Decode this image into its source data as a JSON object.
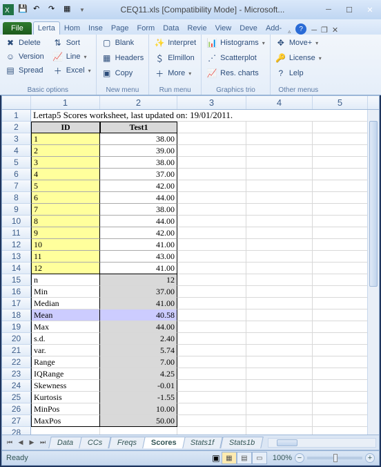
{
  "title": "CEQ11.xls  [Compatibility Mode] - Microsoft...",
  "tabs": {
    "file": "File",
    "active": "Lerta",
    "others": [
      "Hom",
      "Inse",
      "Page",
      "Form",
      "Data",
      "Revie",
      "View",
      "Deve",
      "Add-"
    ]
  },
  "ribbon": {
    "g1": {
      "label": "Basic options",
      "delete": "Delete",
      "version": "Version",
      "spread": "Spread",
      "sort": "Sort",
      "line": "Line",
      "excel": "Excel"
    },
    "g2": {
      "label": "New menu",
      "blank": "Blank",
      "headers": "Headers",
      "copy": "Copy"
    },
    "g3": {
      "label": "Run menu",
      "interpret": "Interpret",
      "elmillon": "Elmillon",
      "more": "More"
    },
    "g4": {
      "label": "Graphics trio",
      "histograms": "Histograms",
      "scatterplot": "Scatterplot",
      "rescharts": "Res. charts"
    },
    "g5": {
      "label": "Other menus",
      "move": "Move+",
      "license": "License",
      "lelp": "Lelp"
    }
  },
  "columns": [
    "1",
    "2",
    "3",
    "4",
    "5"
  ],
  "row_title": "Lertap5 Scores worksheet, last updated on: 19/01/2011.",
  "headers": {
    "id": "ID",
    "test": "Test1"
  },
  "data_rows": [
    {
      "r": "3",
      "id": "1",
      "v": "38.00"
    },
    {
      "r": "4",
      "id": "2",
      "v": "39.00"
    },
    {
      "r": "5",
      "id": "3",
      "v": "38.00"
    },
    {
      "r": "6",
      "id": "4",
      "v": "37.00"
    },
    {
      "r": "7",
      "id": "5",
      "v": "42.00"
    },
    {
      "r": "8",
      "id": "6",
      "v": "44.00"
    },
    {
      "r": "9",
      "id": "7",
      "v": "38.00"
    },
    {
      "r": "10",
      "id": "8",
      "v": "44.00"
    },
    {
      "r": "11",
      "id": "9",
      "v": "42.00"
    },
    {
      "r": "12",
      "id": "10",
      "v": "41.00"
    },
    {
      "r": "13",
      "id": "11",
      "v": "43.00"
    },
    {
      "r": "14",
      "id": "12",
      "v": "41.00"
    }
  ],
  "stat_rows": [
    {
      "r": "15",
      "l": "n",
      "v": "12"
    },
    {
      "r": "16",
      "l": "Min",
      "v": "37.00"
    },
    {
      "r": "17",
      "l": "Median",
      "v": "41.00"
    },
    {
      "r": "18",
      "l": "Mean",
      "v": "40.58",
      "sel": true
    },
    {
      "r": "19",
      "l": "Max",
      "v": "44.00"
    },
    {
      "r": "20",
      "l": "s.d.",
      "v": "2.40"
    },
    {
      "r": "21",
      "l": "var.",
      "v": "5.74"
    },
    {
      "r": "22",
      "l": "Range",
      "v": "7.00"
    },
    {
      "r": "23",
      "l": "IQRange",
      "v": "4.25"
    },
    {
      "r": "24",
      "l": "Skewness",
      "v": "-0.01"
    },
    {
      "r": "25",
      "l": "Kurtosis",
      "v": "-1.55"
    },
    {
      "r": "26",
      "l": "MinPos",
      "v": "10.00"
    },
    {
      "r": "27",
      "l": "MaxPos",
      "v": "50.00"
    }
  ],
  "empty_row": "28",
  "sheet_tabs": [
    "Data",
    "CCs",
    "Freqs",
    "Scores",
    "Stats1f",
    "Stats1b"
  ],
  "active_sheet": "Scores",
  "status": "Ready",
  "zoom": "100%",
  "chart_data": {
    "type": "table",
    "title": "Lertap5 Scores worksheet",
    "updated": "19/01/2011",
    "series": [
      {
        "name": "Test1",
        "ids": [
          1,
          2,
          3,
          4,
          5,
          6,
          7,
          8,
          9,
          10,
          11,
          12
        ],
        "values": [
          38,
          39,
          38,
          37,
          42,
          44,
          38,
          44,
          42,
          41,
          43,
          41
        ]
      }
    ],
    "stats": {
      "n": 12,
      "Min": 37.0,
      "Median": 41.0,
      "Mean": 40.58,
      "Max": 44.0,
      "s.d.": 2.4,
      "var.": 5.74,
      "Range": 7.0,
      "IQRange": 4.25,
      "Skewness": -0.01,
      "Kurtosis": -1.55,
      "MinPos": 10.0,
      "MaxPos": 50.0
    }
  }
}
